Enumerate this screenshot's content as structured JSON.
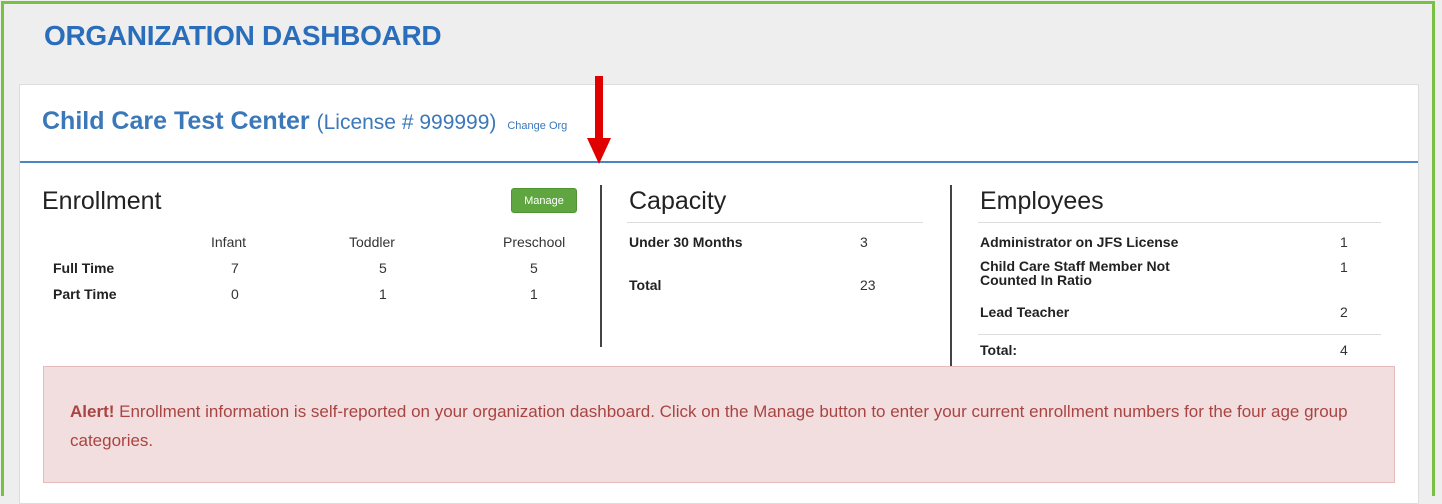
{
  "page": {
    "title": "ORGANIZATION DASHBOARD"
  },
  "org": {
    "name": "Child Care Test Center",
    "license": "(License # 999999)",
    "change_label": "Change Org"
  },
  "enrollment": {
    "title": "Enrollment",
    "manage_label": "Manage",
    "columns": [
      "Infant",
      "Toddler",
      "Preschool"
    ],
    "rows": [
      {
        "label": "Full Time",
        "values": [
          "7",
          "5",
          "5"
        ]
      },
      {
        "label": "Part Time",
        "values": [
          "0",
          "1",
          "1"
        ]
      }
    ]
  },
  "capacity": {
    "title": "Capacity",
    "rows": [
      {
        "label": "Under 30 Months",
        "value": "3"
      },
      {
        "label": "Total",
        "value": "23"
      }
    ]
  },
  "employees": {
    "title": "Employees",
    "rows": [
      {
        "label": "Administrator on JFS License",
        "value": "1"
      },
      {
        "label": "Child Care Staff Member Not Counted In Ratio",
        "value": "1"
      },
      {
        "label": "Lead Teacher",
        "value": "2"
      }
    ],
    "total_label": "Total:",
    "total_value": "4"
  },
  "alert": {
    "strong": "Alert!",
    "message": " Enrollment information is self-reported on your organization dashboard. Click on the Manage button to enter your current enrollment numbers for the four age group categories."
  },
  "colors": {
    "brand_blue": "#2a6ebb",
    "frame_green": "#7ac143",
    "manage_green": "#5fa641",
    "arrow_red": "#e00000",
    "alert_bg": "#f2dede",
    "alert_text": "#a94442"
  }
}
